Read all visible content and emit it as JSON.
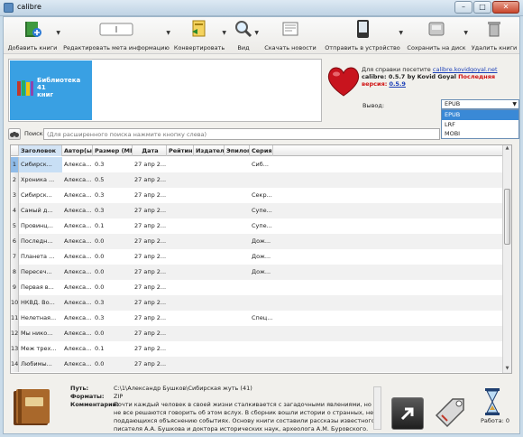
{
  "window": {
    "title": "calibre",
    "minimize": "–",
    "maximize": "□",
    "close": "✕"
  },
  "toolbar": {
    "add_books": "Добавить книги",
    "edit_meta": "Редактировать мета информацию",
    "convert": "Конвертировать",
    "view": "Вид",
    "fetch_news": "Скачать новости",
    "send_device": "Отправить в устройство",
    "save_disk": "Сохранить на диск",
    "delete_books": "Удалить книги"
  },
  "library": {
    "line1": "Библиотека",
    "line2": "41",
    "line3": "книг"
  },
  "info": {
    "help_prefix": "Для справки посетите",
    "help_link": "calibre.kovidgoyal.net",
    "version_line": "calibre: 0.5.7 by",
    "author": "Kovid Goyal",
    "latest_label": "Последняя версия:",
    "latest_version": "0.5.9"
  },
  "output": {
    "label": "Вывод:",
    "selected": "EPUB",
    "options": [
      "EPUB",
      "LRF",
      "MOBI"
    ]
  },
  "search": {
    "label": "Поиск:",
    "placeholder": "(Для расширенного поиска нажмите кнопку слева)"
  },
  "table": {
    "headers": [
      "Заголовок",
      "Автор(ы)",
      "Размер (МБ)",
      "Дата",
      "Рейтинг",
      "Издатель",
      "Эпилог",
      "Серия"
    ],
    "rows": [
      {
        "n": "1",
        "title": "Сибирск...",
        "author": "Алекса...",
        "size": "0.3",
        "date": "27 апр 2...",
        "series": "Сиб..."
      },
      {
        "n": "2",
        "title": "Хроника ...",
        "author": "Алекса...",
        "size": "0.5",
        "date": "27 апр 2...",
        "series": ""
      },
      {
        "n": "3",
        "title": "Сибирск...",
        "author": "Алекса...",
        "size": "0.3",
        "date": "27 апр 2...",
        "series": "Секр..."
      },
      {
        "n": "4",
        "title": "Самый д...",
        "author": "Алекса...",
        "size": "0.3",
        "date": "27 апр 2...",
        "series": "Супе..."
      },
      {
        "n": "5",
        "title": "Провинц...",
        "author": "Алекса...",
        "size": "0.1",
        "date": "27 апр 2...",
        "series": "Супе..."
      },
      {
        "n": "6",
        "title": "Последн...",
        "author": "Алекса...",
        "size": "0.0",
        "date": "27 апр 2...",
        "series": "Дож..."
      },
      {
        "n": "7",
        "title": "Планета ...",
        "author": "Алекса...",
        "size": "0.0",
        "date": "27 апр 2...",
        "series": "Дож..."
      },
      {
        "n": "8",
        "title": "Пересеч...",
        "author": "Алекса...",
        "size": "0.0",
        "date": "27 апр 2...",
        "series": "Дож..."
      },
      {
        "n": "9",
        "title": "Первая в...",
        "author": "Алекса...",
        "size": "0.0",
        "date": "27 апр 2...",
        "series": ""
      },
      {
        "n": "10",
        "title": "НКВД. Во...",
        "author": "Алекса...",
        "size": "0.3",
        "date": "27 апр 2...",
        "series": ""
      },
      {
        "n": "11",
        "title": "Нелетная...",
        "author": "Алекса...",
        "size": "0.3",
        "date": "27 апр 2...",
        "series": "Спец..."
      },
      {
        "n": "12",
        "title": "Мы нико...",
        "author": "Алекса...",
        "size": "0.0",
        "date": "27 апр 2...",
        "series": ""
      },
      {
        "n": "13",
        "title": "Меж трех...",
        "author": "Алекса...",
        "size": "0.1",
        "date": "27 апр 2...",
        "series": ""
      },
      {
        "n": "14",
        "title": "Любимы...",
        "author": "Алекса...",
        "size": "0.0",
        "date": "27 апр 2...",
        "series": ""
      }
    ]
  },
  "details": {
    "path_label": "Путь:",
    "path": "C:\\1\\Александр Бушков\\Сибирская жуть (41)",
    "formats_label": "Форматы:",
    "formats": "ZIP",
    "comments_label": "Комментарии:",
    "comments": "Почти каждый человек в своей жизни сталкивается с загадочными явлениями, но не все решаются говорить об этом вслух. В сборник вошли истории о странных, не поддающихся объяснению событиях. Основу книги составили рассказы известного писателя А.А. Бушкова и доктора исторических наук, археолога А.М. Буровского."
  },
  "jobs": {
    "label": "Работа: 0"
  },
  "colors": {
    "library_tile": "#39a0e3",
    "latest_version": "#d01010",
    "link": "#1b3fb7",
    "selection": "#3a89d6"
  }
}
